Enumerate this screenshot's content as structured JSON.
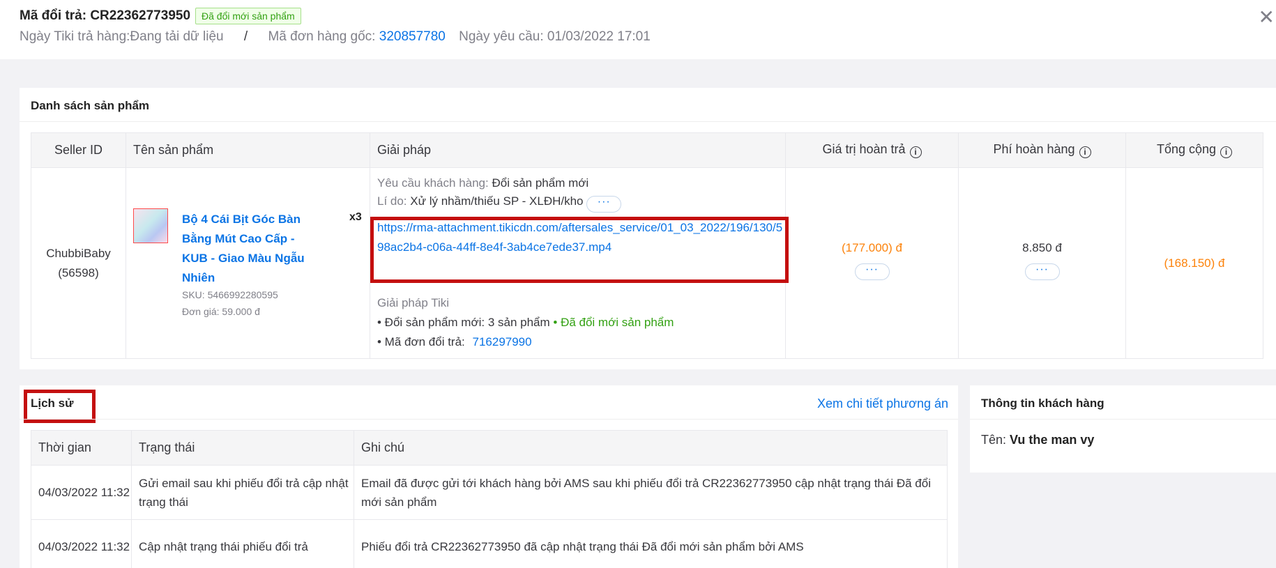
{
  "header": {
    "title_prefix": "Mã đổi trả: CR22362773950",
    "status_badge": "Đã đổi mới sản phẩm",
    "return_date": "Ngày Tiki trả hàng:Đang tải dữ liệu",
    "separator": "/",
    "order_label": "Mã đơn hàng gốc: ",
    "order_id": "320857780",
    "request_date": "Ngày yêu cầu: 01/03/2022 17:01",
    "close_glyph": "✕"
  },
  "products": {
    "title": "Danh sách sản phẩm",
    "columns": [
      "Seller ID",
      "Tên sản phẩm",
      "Giải pháp",
      "Giá trị hoàn trả",
      "Phí hoàn hàng",
      "Tổng cộng"
    ],
    "info_glyph": "i",
    "row": {
      "seller_name": "ChubbiBaby",
      "seller_id": "(56598)",
      "product_name": "Bộ 4 Cái Bịt Góc Bàn Bằng Mút Cao Cấp - KUB - Giao Màu Ngẫu Nhiên",
      "quantity": "x3",
      "sku": "SKU: 5466992280595",
      "unit_price": "Đơn giá: 59.000 đ",
      "customer_request_label": "Yêu cầu khách hàng:",
      "customer_request_value": "Đổi sản phẩm mới",
      "reason_label": "Lí do:",
      "reason_value": "Xử lý nhầm/thiếu SP - XLĐH/kho",
      "attachment_url": "https://rma-attachment.tikicdn.com/aftersales_service/01_03_2022/196/130/598ac2b4-c06a-44ff-8e4f-3ab4ce7ede37.mp4",
      "tiki_solution_label": "Giải pháp Tiki",
      "exchange_label": "• Đổi sản phẩm mới: 3 sản phẩm",
      "exchange_status": "• Đã đổi mới sản phẩm",
      "return_code_label": "• Mã đơn đổi trả:",
      "return_code_value": "716297990",
      "refund_value": "(177.000) đ",
      "return_fee": "8.850 đ",
      "total": "(168.150) đ",
      "more_glyph": "···"
    }
  },
  "history": {
    "title": "Lịch sử",
    "detail_link": "Xem chi tiết phương án",
    "columns": [
      "Thời gian",
      "Trạng thái",
      "Ghi chú"
    ],
    "rows": [
      {
        "time": "04/03/2022 11:32",
        "status": "Gửi email sau khi phiếu đổi trả cập nhật trạng thái",
        "note": "Email đã được gửi tới khách hàng bởi AMS sau khi phiếu đổi trả CR22362773950 cập nhật trạng thái Đã đổi mới sản phẩm"
      },
      {
        "time": "04/03/2022 11:32",
        "status": "Cập nhật trạng thái phiếu đổi trả",
        "note": "Phiếu đổi trả CR22362773950 đã cập nhật trạng thái Đã đổi mới sản phẩm bởi AMS"
      }
    ]
  },
  "customer": {
    "title": "Thông tin khách hàng",
    "name_label": "Tên:",
    "name_value": "Vu the man vy"
  },
  "colors": {
    "accent_blue": "#0b74e5",
    "orange": "#fc820a",
    "green": "#33a113",
    "highlight_red": "#c40e0e"
  }
}
